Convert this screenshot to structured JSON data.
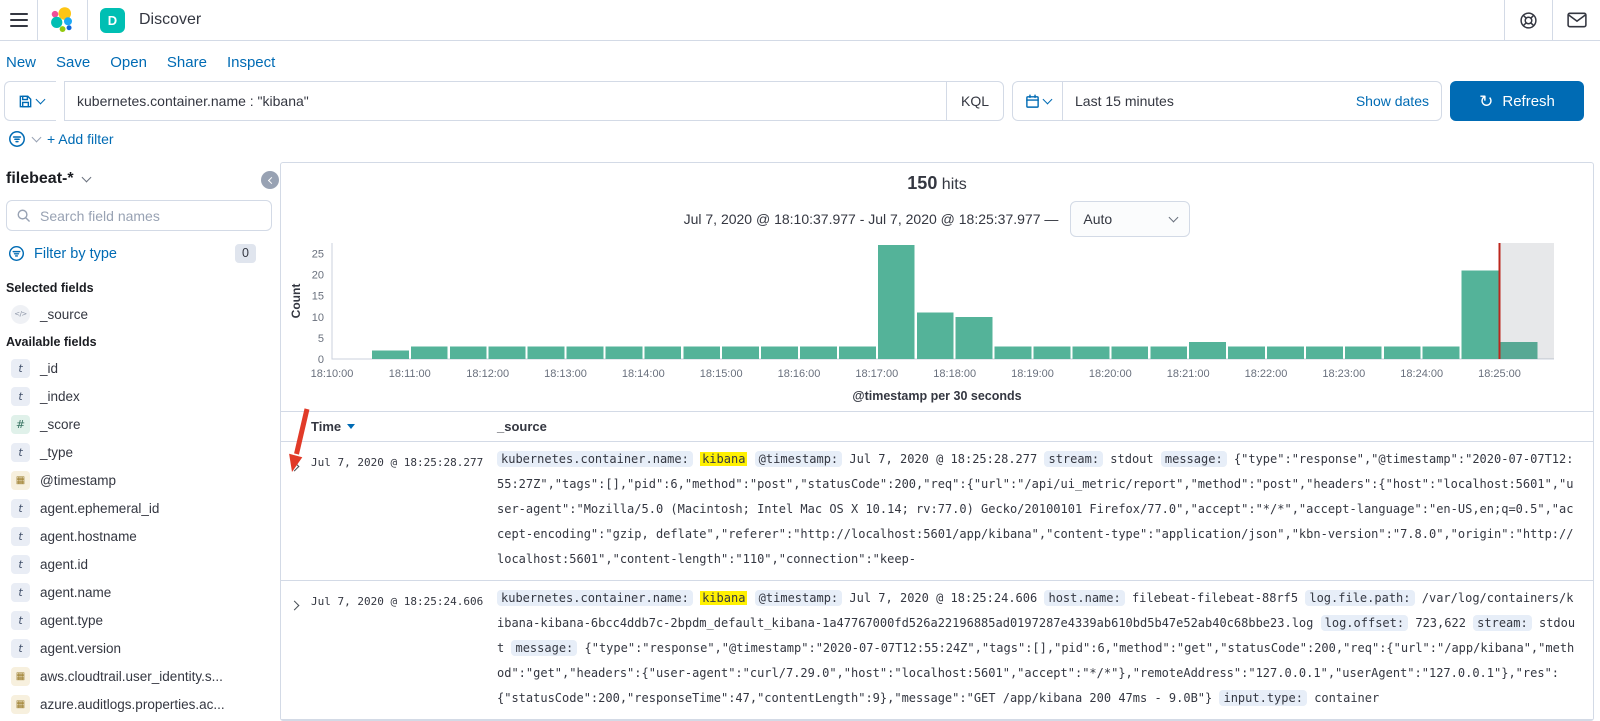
{
  "colors": {
    "accent": "#006BB4",
    "text": "#343741",
    "subdued": "#69707D",
    "border": "#D3DAE6",
    "bar": "#54B399",
    "current_time_line": "#BD271E",
    "partial_overlay": "rgba(105,115,125,0.16)",
    "highlight": "#FFF102",
    "field_badge_bg": "#E7EEF8",
    "discover_badge_bg": "#00BFB3",
    "annotation": "#E13A28"
  },
  "header": {
    "title": "Discover",
    "app_badge": "D"
  },
  "nav": {
    "links": [
      "New",
      "Save",
      "Open",
      "Share",
      "Inspect"
    ]
  },
  "search_bar": {
    "query": "kubernetes.container.name : \"kibana\"",
    "language_label": "KQL",
    "time_range": "Last 15 minutes",
    "show_dates_label": "Show dates",
    "refresh_label": "Refresh"
  },
  "filter_bar": {
    "add_filter_label": "+ Add filter"
  },
  "sidebar": {
    "index_pattern": "filebeat-*",
    "search_placeholder": "Search field names",
    "filter_by_type_label": "Filter by type",
    "filter_count": "0",
    "selected_heading": "Selected fields",
    "available_heading": "Available fields",
    "selected_fields": [
      {
        "name": "_source",
        "type": "source"
      }
    ],
    "available_fields": [
      {
        "name": "_id",
        "type": "string"
      },
      {
        "name": "_index",
        "type": "string"
      },
      {
        "name": "_score",
        "type": "number"
      },
      {
        "name": "_type",
        "type": "string"
      },
      {
        "name": "@timestamp",
        "type": "date"
      },
      {
        "name": "agent.ephemeral_id",
        "type": "string"
      },
      {
        "name": "agent.hostname",
        "type": "string"
      },
      {
        "name": "agent.id",
        "type": "string"
      },
      {
        "name": "agent.name",
        "type": "string"
      },
      {
        "name": "agent.type",
        "type": "string"
      },
      {
        "name": "agent.version",
        "type": "string"
      },
      {
        "name": "aws.cloudtrail.user_identity.s...",
        "type": "date"
      },
      {
        "name": "azure.auditlogs.properties.ac...",
        "type": "date"
      }
    ]
  },
  "results_header": {
    "hits_count": "150",
    "hits_label": "hits",
    "time_range_display": "Jul 7, 2020 @ 18:10:37.977 - Jul 7, 2020 @ 18:25:37.977 —",
    "interval_selected": "Auto"
  },
  "chart_data": {
    "type": "bar",
    "title": "",
    "xlabel": "@timestamp per 30 seconds",
    "ylabel": "Count",
    "ylim": [
      0,
      27
    ],
    "y_ticks": [
      0,
      5,
      10,
      15,
      20,
      25
    ],
    "x_tick_labels": [
      "18:10:00",
      "18:11:00",
      "18:12:00",
      "18:13:00",
      "18:14:00",
      "18:15:00",
      "18:16:00",
      "18:17:00",
      "18:18:00",
      "18:19:00",
      "18:20:00",
      "18:21:00",
      "18:22:00",
      "18:23:00",
      "18:24:00",
      "18:25:00"
    ],
    "bucket_interval_seconds": 30,
    "categories": [
      "18:10:00",
      "18:10:30",
      "18:11:00",
      "18:11:30",
      "18:12:00",
      "18:12:30",
      "18:13:00",
      "18:13:30",
      "18:14:00",
      "18:14:30",
      "18:15:00",
      "18:15:30",
      "18:16:00",
      "18:16:30",
      "18:17:00",
      "18:17:30",
      "18:18:00",
      "18:18:30",
      "18:19:00",
      "18:19:30",
      "18:20:00",
      "18:20:30",
      "18:21:00",
      "18:21:30",
      "18:22:00",
      "18:22:30",
      "18:23:00",
      "18:23:30",
      "18:24:00",
      "18:24:30",
      "18:25:00"
    ],
    "values": [
      0,
      2,
      3,
      3,
      3,
      3,
      3,
      3,
      3,
      3,
      3,
      3,
      3,
      3,
      27,
      11,
      10,
      3,
      3,
      3,
      3,
      3,
      4,
      3,
      3,
      3,
      3,
      3,
      3,
      21,
      4
    ],
    "partial_data_from": "18:25:00",
    "bar_color": "#54B399",
    "grid": false,
    "legend": false
  },
  "table": {
    "columns": [
      "Time",
      "_source"
    ],
    "sort_column": "Time",
    "rows": [
      {
        "time": "Jul 7, 2020 @ 18:25:28.277",
        "segments": [
          {
            "t": "field",
            "v": "kubernetes.container.name:"
          },
          {
            "t": "mark",
            "v": "kibana"
          },
          {
            "t": "field",
            "v": "@timestamp:"
          },
          {
            "t": "text",
            "v": "Jul 7, 2020 @ 18:25:28.277"
          },
          {
            "t": "field",
            "v": "stream:"
          },
          {
            "t": "text",
            "v": "stdout"
          },
          {
            "t": "field",
            "v": "message:"
          },
          {
            "t": "text",
            "v": "{\"type\":\"response\",\"@timestamp\":\"2020-07-07T12:55:27Z\",\"tags\":[],\"pid\":6,\"method\":\"post\",\"statusCode\":200,\"req\":{\"url\":\"/api/ui_metric/report\",\"method\":\"post\",\"headers\":{\"host\":\"localhost:5601\",\"user-agent\":\"Mozilla/5.0 (Macintosh; Intel Mac OS X 10.14; rv:77.0) Gecko/20100101 Firefox/77.0\",\"accept\":\"*/*\",\"accept-language\":\"en-US,en;q=0.5\",\"accept-encoding\":\"gzip, deflate\",\"referer\":\"http://localhost:5601/app/kibana\",\"content-type\":\"application/json\",\"kbn-version\":\"7.8.0\",\"origin\":\"http://localhost:5601\",\"content-length\":\"110\",\"connection\":\"keep-"
          }
        ]
      },
      {
        "time": "Jul 7, 2020 @ 18:25:24.606",
        "segments": [
          {
            "t": "field",
            "v": "kubernetes.container.name:"
          },
          {
            "t": "mark",
            "v": "kibana"
          },
          {
            "t": "field",
            "v": "@timestamp:"
          },
          {
            "t": "text",
            "v": "Jul 7, 2020 @ 18:25:24.606"
          },
          {
            "t": "field",
            "v": "host.name:"
          },
          {
            "t": "text",
            "v": "filebeat-filebeat-88rf5"
          },
          {
            "t": "field",
            "v": "log.file.path:"
          },
          {
            "t": "text",
            "v": "/var/log/containers/kibana-kibana-6bcc4ddb7c-2bpdm_default_kibana-1a47767000fd526a22196885ad0197287e4339ab610bd5b47e52ab40c68bbe23.log"
          },
          {
            "t": "field",
            "v": "log.offset:"
          },
          {
            "t": "text",
            "v": "723,622"
          },
          {
            "t": "field",
            "v": "stream:"
          },
          {
            "t": "text",
            "v": "stdout"
          },
          {
            "t": "field",
            "v": "message:"
          },
          {
            "t": "text",
            "v": "{\"type\":\"response\",\"@timestamp\":\"2020-07-07T12:55:24Z\",\"tags\":[],\"pid\":6,\"method\":\"get\",\"statusCode\":200,\"req\":{\"url\":\"/app/kibana\",\"method\":\"get\",\"headers\":{\"user-agent\":\"curl/7.29.0\",\"host\":\"localhost:5601\",\"accept\":\"*/*\"},\"remoteAddress\":\"127.0.0.1\",\"userAgent\":\"127.0.0.1\"},\"res\":{\"statusCode\":200,\"responseTime\":47,\"contentLength\":9},\"message\":\"GET /app/kibana 200 47ms - 9.0B\"}"
          },
          {
            "t": "field",
            "v": "input.type:"
          },
          {
            "t": "text",
            "v": "container"
          }
        ]
      }
    ]
  }
}
